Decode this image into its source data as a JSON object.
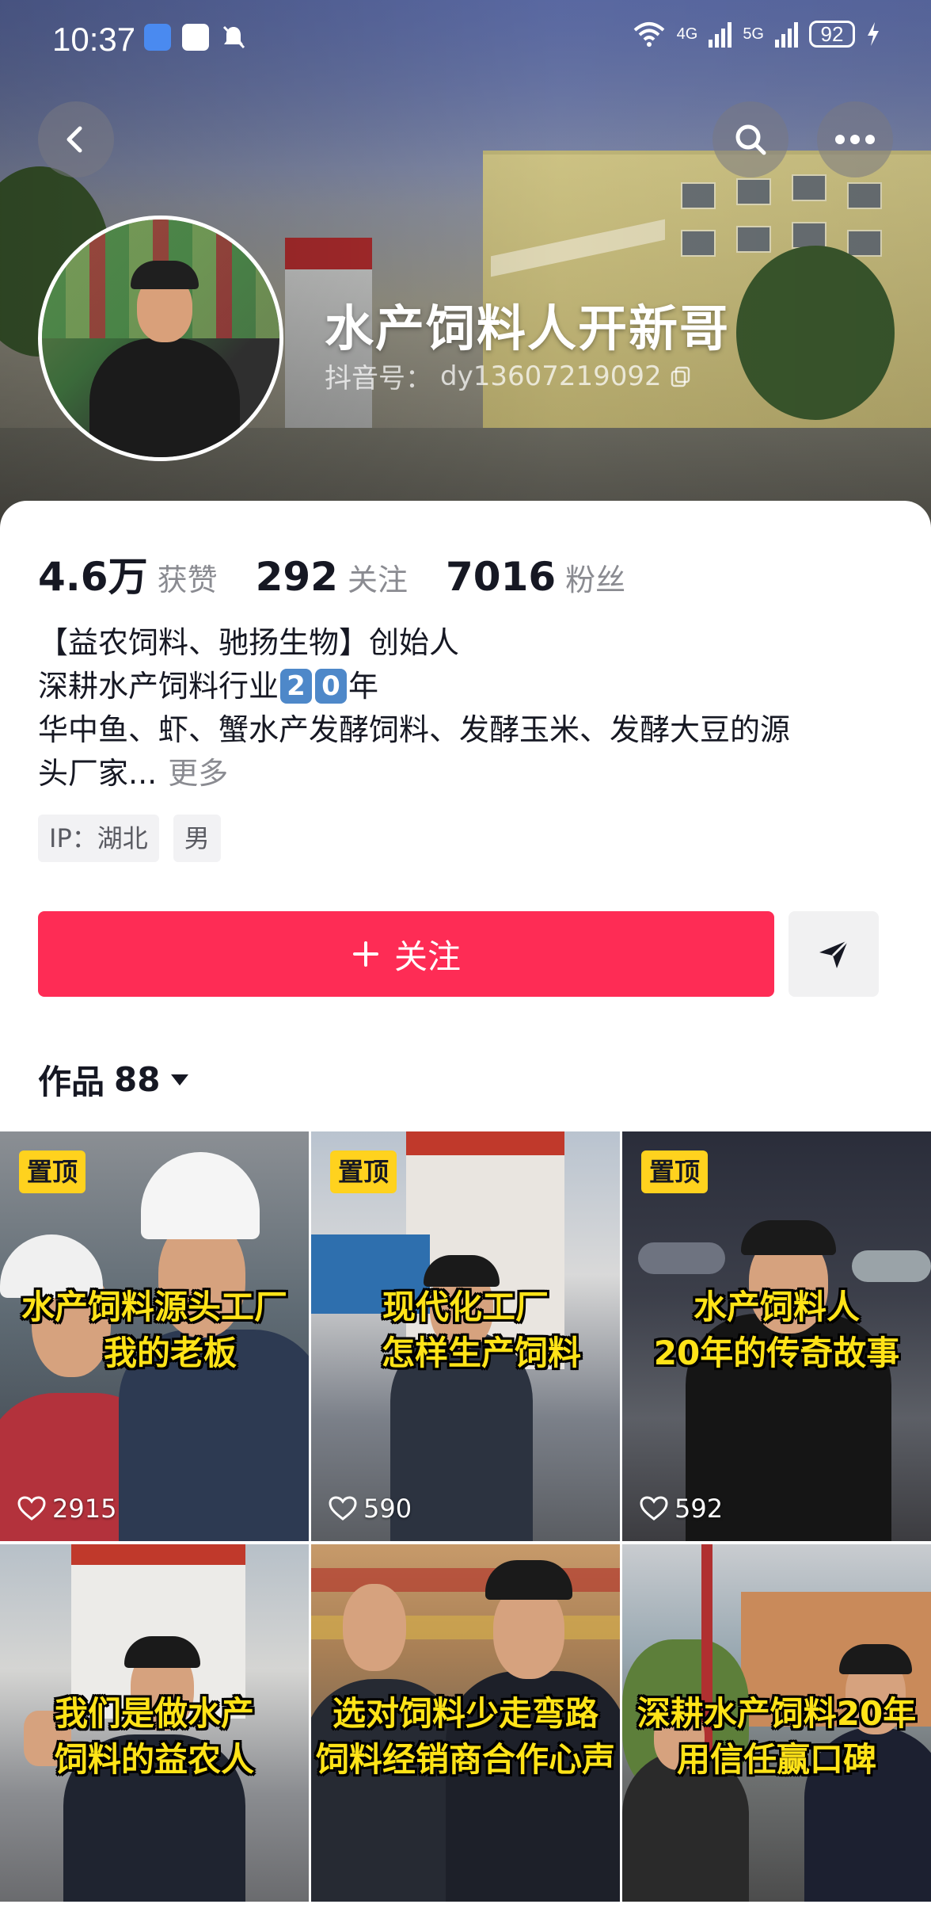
{
  "status_bar": {
    "time": "10:37",
    "network_4g": "4G",
    "network_5g": "5G",
    "battery": "92"
  },
  "profile": {
    "name": "水产饲料人开新哥",
    "id_label": "抖音号：",
    "id_value": "dy13607219092"
  },
  "stats": [
    {
      "value": "4.6万",
      "label": "获赞"
    },
    {
      "value": "292",
      "label": "关注"
    },
    {
      "value": "7016",
      "label": "粉丝"
    }
  ],
  "bio": {
    "line1": "【益农饲料、驰扬生物】创始人",
    "line2_prefix": "深耕水产饲料行业",
    "line2_badge_1": "2",
    "line2_badge_2": "0",
    "line2_suffix": "年",
    "line3": "华中鱼、虾、蟹水产发酵饲料、发酵玉米、发酵大豆的源",
    "line4": "头厂家...",
    "more": "更多"
  },
  "tags": [
    "IP：湖北",
    "男"
  ],
  "actions": {
    "follow_label": "关注",
    "follow_icon": "plus-icon",
    "share_icon": "send-icon"
  },
  "works": {
    "label": "作品",
    "count": "88"
  },
  "videos": [
    {
      "pinned": "置顶",
      "caption_line1": "水产饲料源头工厂",
      "caption_line2": "我的老板",
      "likes": "2915"
    },
    {
      "pinned": "置顶",
      "caption_line1": "现代化工厂",
      "caption_line2": "怎样生产饲料",
      "likes": "590"
    },
    {
      "pinned": "置顶",
      "caption_line1": "水产饲料人",
      "caption_line2": "20年的传奇故事",
      "likes": "592"
    },
    {
      "pinned": "",
      "caption_line1": "我们是做水产",
      "caption_line2": "饲料的益农人",
      "likes": ""
    },
    {
      "pinned": "",
      "caption_line1": "选对饲料少走弯路",
      "caption_line2": "饲料经销商合作心声",
      "likes": ""
    },
    {
      "pinned": "",
      "caption_line1": "深耕水产饲料20年",
      "caption_line2": "用信任赢口碑",
      "likes": ""
    }
  ]
}
